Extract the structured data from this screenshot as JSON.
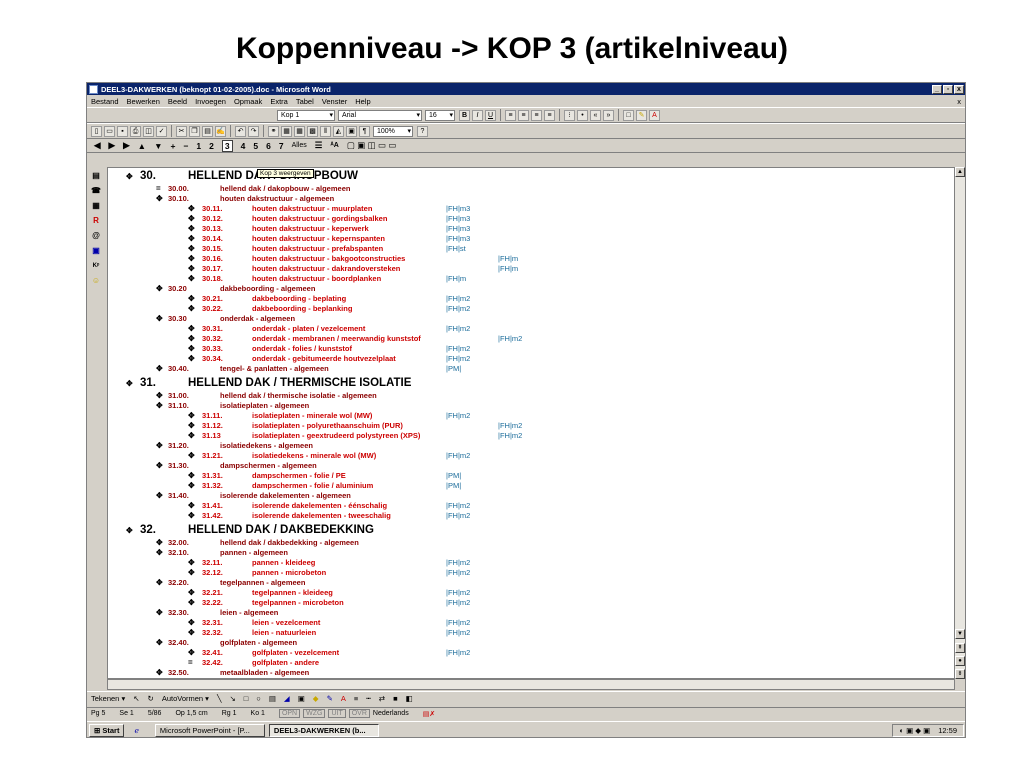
{
  "slide": {
    "title": "Koppenniveau -> KOP 3 (artikelniveau)"
  },
  "window": {
    "title": "DEEL3-DAKWERKEN (beknopt 01-02-2005).doc - Microsoft Word",
    "min": "_",
    "max": "▫",
    "close": "x"
  },
  "menu": [
    "Bestand",
    "Bewerken",
    "Beeld",
    "Invoegen",
    "Opmaak",
    "Extra",
    "Tabel",
    "Venster",
    "Help"
  ],
  "menu_close": "x",
  "format_toolbar": {
    "style": "Kop 1",
    "font": "Arial",
    "size": "16",
    "bold": "B",
    "italic": "I",
    "underline": "U"
  },
  "standard_toolbar": {
    "zoom": "100%"
  },
  "outline_toolbar": {
    "levels": [
      "1",
      "2",
      "3",
      "4",
      "5",
      "6",
      "7"
    ],
    "all": "Alles"
  },
  "tooltip": "Kop 3 weergeven",
  "outline": [
    {
      "lvl": 1,
      "num": "30.",
      "txt": "HELLEND DAK / DAKOPBOUW",
      "tag": ""
    },
    {
      "lvl": 2,
      "sym": "=",
      "num": "30.00.",
      "txt": "hellend dak / dakopbouw - algemeen",
      "tag": ""
    },
    {
      "lvl": 2,
      "num": "30.10.",
      "txt": "houten dakstructuur - algemeen",
      "tag": ""
    },
    {
      "lvl": 3,
      "num": "30.11.",
      "txt": "houten dakstructuur - muurplaten",
      "tag": "|FH|m3"
    },
    {
      "lvl": 3,
      "num": "30.12.",
      "txt": "houten dakstructuur - gordingsbalken",
      "tag": "|FH|m3"
    },
    {
      "lvl": 3,
      "num": "30.13.",
      "txt": "houten dakstructuur - keperwerk",
      "tag": "|FH|m3"
    },
    {
      "lvl": 3,
      "num": "30.14.",
      "txt": "houten dakstructuur - kepernspanten",
      "tag": "|FH|m3"
    },
    {
      "lvl": 3,
      "num": "30.15.",
      "txt": "houten dakstructuur - prefabspanten",
      "tag": "|FH|st"
    },
    {
      "lvl": 3,
      "num": "30.16.",
      "txt": "houten dakstructuur - bakgootconstructies",
      "tag": "|FH|m"
    },
    {
      "lvl": 3,
      "num": "30.17.",
      "txt": "houten dakstructuur - dakrandoversteken",
      "tag": "|FH|m"
    },
    {
      "lvl": 3,
      "num": "30.18.",
      "txt": "houten dakstructuur - boordplanken",
      "tag": "|FH|m"
    },
    {
      "lvl": 2,
      "num": "30.20",
      "txt": "dakbeboording - algemeen",
      "tag": ""
    },
    {
      "lvl": 3,
      "num": "30.21.",
      "txt": "dakbeboording - beplating",
      "tag": "|FH|m2"
    },
    {
      "lvl": 3,
      "num": "30.22.",
      "txt": "dakbeboording - beplanking",
      "tag": "|FH|m2"
    },
    {
      "lvl": 2,
      "num": "30.30",
      "txt": "onderdak - algemeen",
      "tag": ""
    },
    {
      "lvl": 3,
      "num": "30.31.",
      "txt": "onderdak - platen / vezelcement",
      "tag": "|FH|m2"
    },
    {
      "lvl": 3,
      "num": "30.32.",
      "txt": "onderdak - membranen / meerwandig kunststof",
      "tag": "|FH|m2"
    },
    {
      "lvl": 3,
      "num": "30.33.",
      "txt": "onderdak - folies / kunststof",
      "tag": "|FH|m2"
    },
    {
      "lvl": 3,
      "num": "30.34.",
      "txt": "onderdak - gebitumeerde houtvezelplaat",
      "tag": "|FH|m2"
    },
    {
      "lvl": 2,
      "num": "30.40.",
      "txt": "tengel- & panlatten - algemeen",
      "tag": "|PM|"
    },
    {
      "lvl": 1,
      "num": "31.",
      "txt": "HELLEND DAK / THERMISCHE ISOLATIE",
      "tag": ""
    },
    {
      "lvl": 2,
      "num": "31.00.",
      "txt": "hellend dak / thermische isolatie - algemeen",
      "tag": ""
    },
    {
      "lvl": 2,
      "num": "31.10.",
      "txt": "isolatieplaten - algemeen",
      "tag": ""
    },
    {
      "lvl": 3,
      "num": "31.11.",
      "txt": "isolatieplaten - minerale wol (MW)",
      "tag": "|FH|m2"
    },
    {
      "lvl": 3,
      "num": "31.12.",
      "txt": "isolatieplaten - polyurethaanschuim (PUR)",
      "tag": "|FH|m2"
    },
    {
      "lvl": 3,
      "num": "31.13",
      "txt": "isolatieplaten - geextrudeerd polystyreen (XPS)",
      "tag": "|FH|m2"
    },
    {
      "lvl": 2,
      "num": "31.20.",
      "txt": "isolatiedekens - algemeen",
      "tag": ""
    },
    {
      "lvl": 3,
      "num": "31.21.",
      "txt": "isolatiedekens - minerale wol (MW)",
      "tag": "|FH|m2"
    },
    {
      "lvl": 2,
      "num": "31.30.",
      "txt": "dampschermen - algemeen",
      "tag": ""
    },
    {
      "lvl": 3,
      "num": "31.31.",
      "txt": "dampschermen - folie / PE",
      "tag": "|PM|"
    },
    {
      "lvl": 3,
      "num": "31.32.",
      "txt": "dampschermen - folie / aluminium",
      "tag": "|PM|"
    },
    {
      "lvl": 2,
      "num": "31.40.",
      "txt": "isolerende dakelementen - algemeen",
      "tag": ""
    },
    {
      "lvl": 3,
      "num": "31.41.",
      "txt": "isolerende dakelementen - éénschalig",
      "tag": "|FH|m2"
    },
    {
      "lvl": 3,
      "num": "31.42.",
      "txt": "isolerende dakelementen - tweeschalig",
      "tag": "|FH|m2"
    },
    {
      "lvl": 1,
      "num": "32.",
      "txt": "HELLEND DAK / DAKBEDEKKING",
      "tag": ""
    },
    {
      "lvl": 2,
      "num": "32.00.",
      "txt": "hellend dak / dakbedekking - algemeen",
      "tag": ""
    },
    {
      "lvl": 2,
      "num": "32.10.",
      "txt": "pannen - algemeen",
      "tag": ""
    },
    {
      "lvl": 3,
      "num": "32.11.",
      "txt": "pannen - kleideeg",
      "tag": "|FH|m2"
    },
    {
      "lvl": 3,
      "num": "32.12.",
      "txt": "pannen - microbeton",
      "tag": "|FH|m2"
    },
    {
      "lvl": 2,
      "num": "32.20.",
      "txt": "tegelpannen - algemeen",
      "tag": ""
    },
    {
      "lvl": 3,
      "num": "32.21.",
      "txt": "tegelpannen - kleideeg",
      "tag": "|FH|m2"
    },
    {
      "lvl": 3,
      "num": "32.22.",
      "txt": "tegelpannen - microbeton",
      "tag": "|FH|m2"
    },
    {
      "lvl": 2,
      "num": "32.30.",
      "txt": "leien - algemeen",
      "tag": ""
    },
    {
      "lvl": 3,
      "num": "32.31.",
      "txt": "leien - vezelcement",
      "tag": "|FH|m2"
    },
    {
      "lvl": 3,
      "num": "32.32.",
      "txt": "leien - natuurleien",
      "tag": "|FH|m2"
    },
    {
      "lvl": 2,
      "num": "32.40.",
      "txt": "golfplaten - algemeen",
      "tag": ""
    },
    {
      "lvl": 3,
      "num": "32.41.",
      "txt": "golfplaten - vezelcement",
      "tag": "|FH|m2"
    },
    {
      "lvl": 3,
      "sym": "=",
      "num": "32.42.",
      "txt": "golfplaten - andere",
      "tag": ""
    },
    {
      "lvl": 2,
      "num": "32.50.",
      "txt": "metaalbladen - algemeen",
      "tag": ""
    }
  ],
  "drawbar": {
    "draw": "Tekenen ▾",
    "autoshapes": "AutoVormen ▾"
  },
  "status": {
    "page": "Pg 5",
    "section": "Se 1",
    "pos": "5/86",
    "at": "Op 1,5 cm",
    "line": "Rg 1",
    "col": "Ko 1",
    "rec": "OPN",
    "trk": "WZG",
    "ext": "UIT",
    "ovr": "OVR",
    "lang": "Nederlands"
  },
  "taskbar": {
    "start": "Start",
    "task1": "Microsoft PowerPoint - [P...",
    "task2": "DEEL3-DAKWERKEN (b...",
    "clock": "12:59"
  }
}
